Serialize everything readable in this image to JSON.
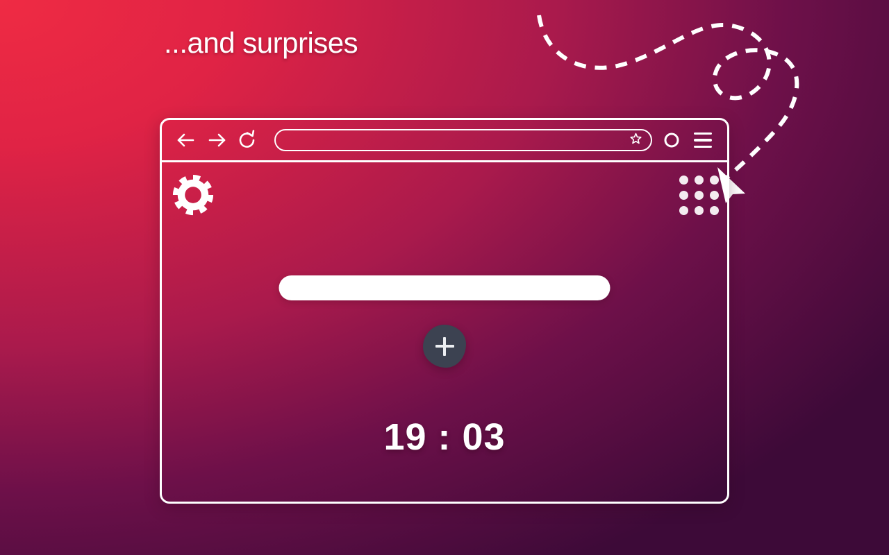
{
  "headline": "...and surprises",
  "background": {
    "gradient_start": "#ef2b44",
    "gradient_mid": "#aa1a4c",
    "gradient_end": "#3d0a38"
  },
  "annotation": {
    "path_name": "dashed-swoosh-path",
    "cursor_name": "arrow-cursor",
    "stroke_color": "#ffffff"
  },
  "browser": {
    "toolbar": {
      "back_label": "Back",
      "forward_label": "Forward",
      "reload_label": "Reload",
      "address": {
        "value": "",
        "placeholder": "",
        "bookmark_label": "Bookmark"
      },
      "profile_label": "Profile",
      "menu_label": "Menu"
    },
    "page": {
      "settings_label": "Settings",
      "apps_label": "Apps",
      "search": {
        "value": "",
        "placeholder": ""
      },
      "add_label": "Add shortcut",
      "clock": "19 : 03",
      "add_button_color": "#3c4251"
    }
  }
}
